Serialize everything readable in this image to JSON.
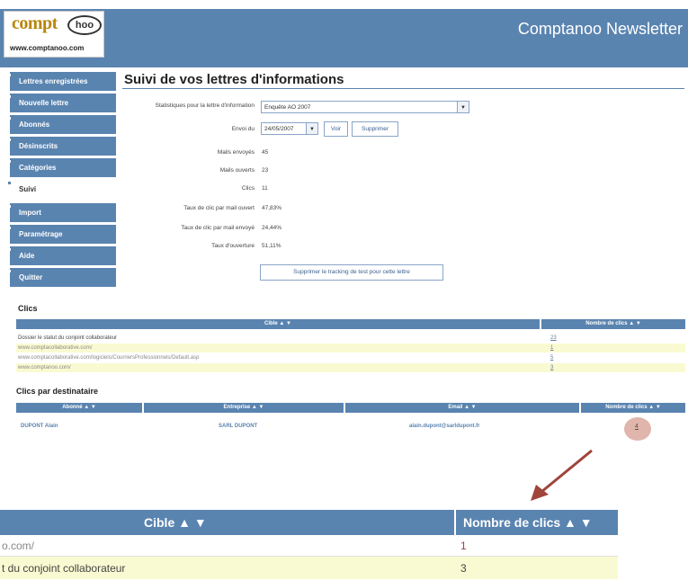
{
  "header": {
    "logo_text": "compt",
    "logo_oval": "hoo",
    "logo_url": "www.comptanoo.com",
    "app_title": "Comptanoo Newsletter"
  },
  "sidebar": {
    "items": [
      {
        "label": "Lettres enregistrées"
      },
      {
        "label": "Nouvelle lettre"
      },
      {
        "label": "Abonnés"
      },
      {
        "label": "Désinscrits"
      },
      {
        "label": "Catégories"
      },
      {
        "label": "Suivi"
      },
      {
        "label": "Import"
      },
      {
        "label": "Paramétrage"
      },
      {
        "label": "Aide"
      },
      {
        "label": "Quitter"
      }
    ]
  },
  "main": {
    "title": "Suivi de vos lettres d'informations",
    "stats_label": "Statistiques pour la lettre d'information",
    "stats_value": "Enquête AO 2007",
    "sent_label": "Envoi du",
    "sent_value": "24/05/2007",
    "view_btn": "Voir",
    "delete_btn": "Supprimer",
    "mails_sent_label": "Mails envoyés",
    "mails_sent": "45",
    "mails_opened_label": "Mails ouverts",
    "mails_opened": "23",
    "clicks_label": "Clics",
    "clicks": "11",
    "ctr_open_label": "Taux de clic par mail ouvert",
    "ctr_open": "47,83%",
    "ctr_sent_label": "Taux de clic par mail envoyé",
    "ctr_sent": "24,44%",
    "open_rate_label": "Taux d'ouverture",
    "open_rate": "51,11%",
    "remove_tracking_btn": "Supprimer le tracking de test pour cette lettre"
  },
  "clics": {
    "title": "Clics",
    "col_target": "Cible ▲ ▼",
    "col_count": "Nombre de clics ▲ ▼",
    "rows": [
      {
        "target": "Dossier le statut du conjoint collaborateur",
        "count": "23"
      },
      {
        "target": "www.comptacollaborative.com/",
        "count": "1"
      },
      {
        "target": "www.comptacollaborative.com/logiciels/CourriersProfessionnels/Default.asp",
        "count": "5"
      },
      {
        "target": "www.comptanoo.com/",
        "count": "3"
      }
    ]
  },
  "dest": {
    "title": "Clics par destinataire",
    "col_subscriber": "Abonné ▲ ▼",
    "col_company": "Entreprise ▲ ▼",
    "col_email": "Email ▲ ▼",
    "col_count": "Nombre de clics ▲ ▼",
    "rows": [
      {
        "subscriber": "DUPONT Alain",
        "company": "SARL DUPONT",
        "email": "alain.dupont@sarldupont.fr",
        "count": "4"
      }
    ]
  },
  "zoom": {
    "col_target": "Cible ▲ ▼",
    "col_count": "Nombre de clics ▲ ▼",
    "row1_target": "o.com/",
    "row1_count": "1",
    "row2_target": "t du conjoint collaborateur",
    "row2_count": "3"
  },
  "colors": {
    "accent": "#5a84b0",
    "row_highlight": "#fafad2",
    "arrow": "#a0443c"
  }
}
